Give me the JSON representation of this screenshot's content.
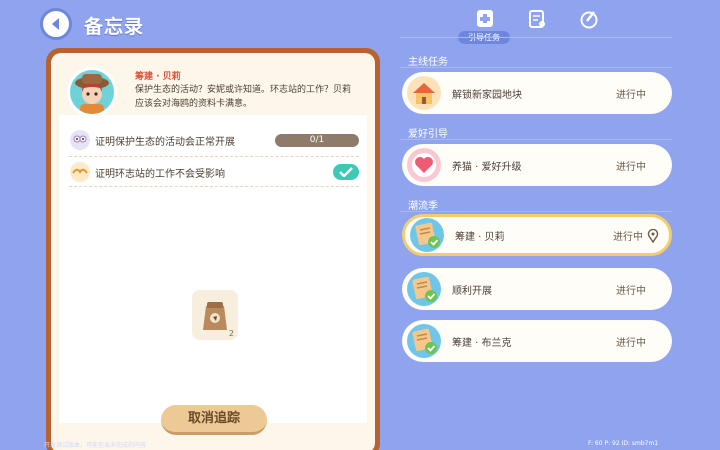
{
  "header": {
    "title": "备忘录"
  },
  "tabs": {
    "active_label": "引导任务",
    "icons": [
      "guide-task-icon",
      "clipboard-icon",
      "collection-icon"
    ]
  },
  "memo": {
    "npc_name": "筹建 · 贝莉",
    "npc_text": "保护生态的活动？安妮或许知道。环志站的工作？贝莉应该会对海鸥的资料卡满意。",
    "tasks": [
      {
        "label": "证明保护生态的活动会正常开展",
        "progress": "0/1",
        "done": false
      },
      {
        "label": "证明环志站的工作不会受影响",
        "done": true
      }
    ],
    "item": {
      "icon": "sack-icon",
      "count": "2"
    },
    "cancel_label": "取消追踪"
  },
  "sections": [
    {
      "label": "主线任务",
      "quests": [
        {
          "title": "解锁新家园地块",
          "status": "进行中",
          "icon": "house-icon"
        }
      ]
    },
    {
      "label": "爱好引导",
      "quests": [
        {
          "title": "养猫 · 爱好升级",
          "status": "进行中",
          "icon": "heart-icon"
        }
      ]
    },
    {
      "label": "潮流季",
      "quests": [
        {
          "title": "筹建 · 贝莉",
          "status": "进行中",
          "icon": "checklist-icon",
          "selected": true
        },
        {
          "title": "顺利开展",
          "status": "进行中",
          "icon": "checklist-icon"
        },
        {
          "title": "筹建 · 布兰克",
          "status": "进行中",
          "icon": "checklist-icon"
        }
      ]
    }
  ],
  "footer": {
    "left": "开发调试版本，可能包含未完成的内容",
    "right": "F: 60   P: 92   ID: smb7m1"
  },
  "colors": {
    "background": "#8fa3ee",
    "frame": "#b7632f",
    "accent_teal": "#3cc9b6",
    "selected_border": "#f3cd6b"
  }
}
